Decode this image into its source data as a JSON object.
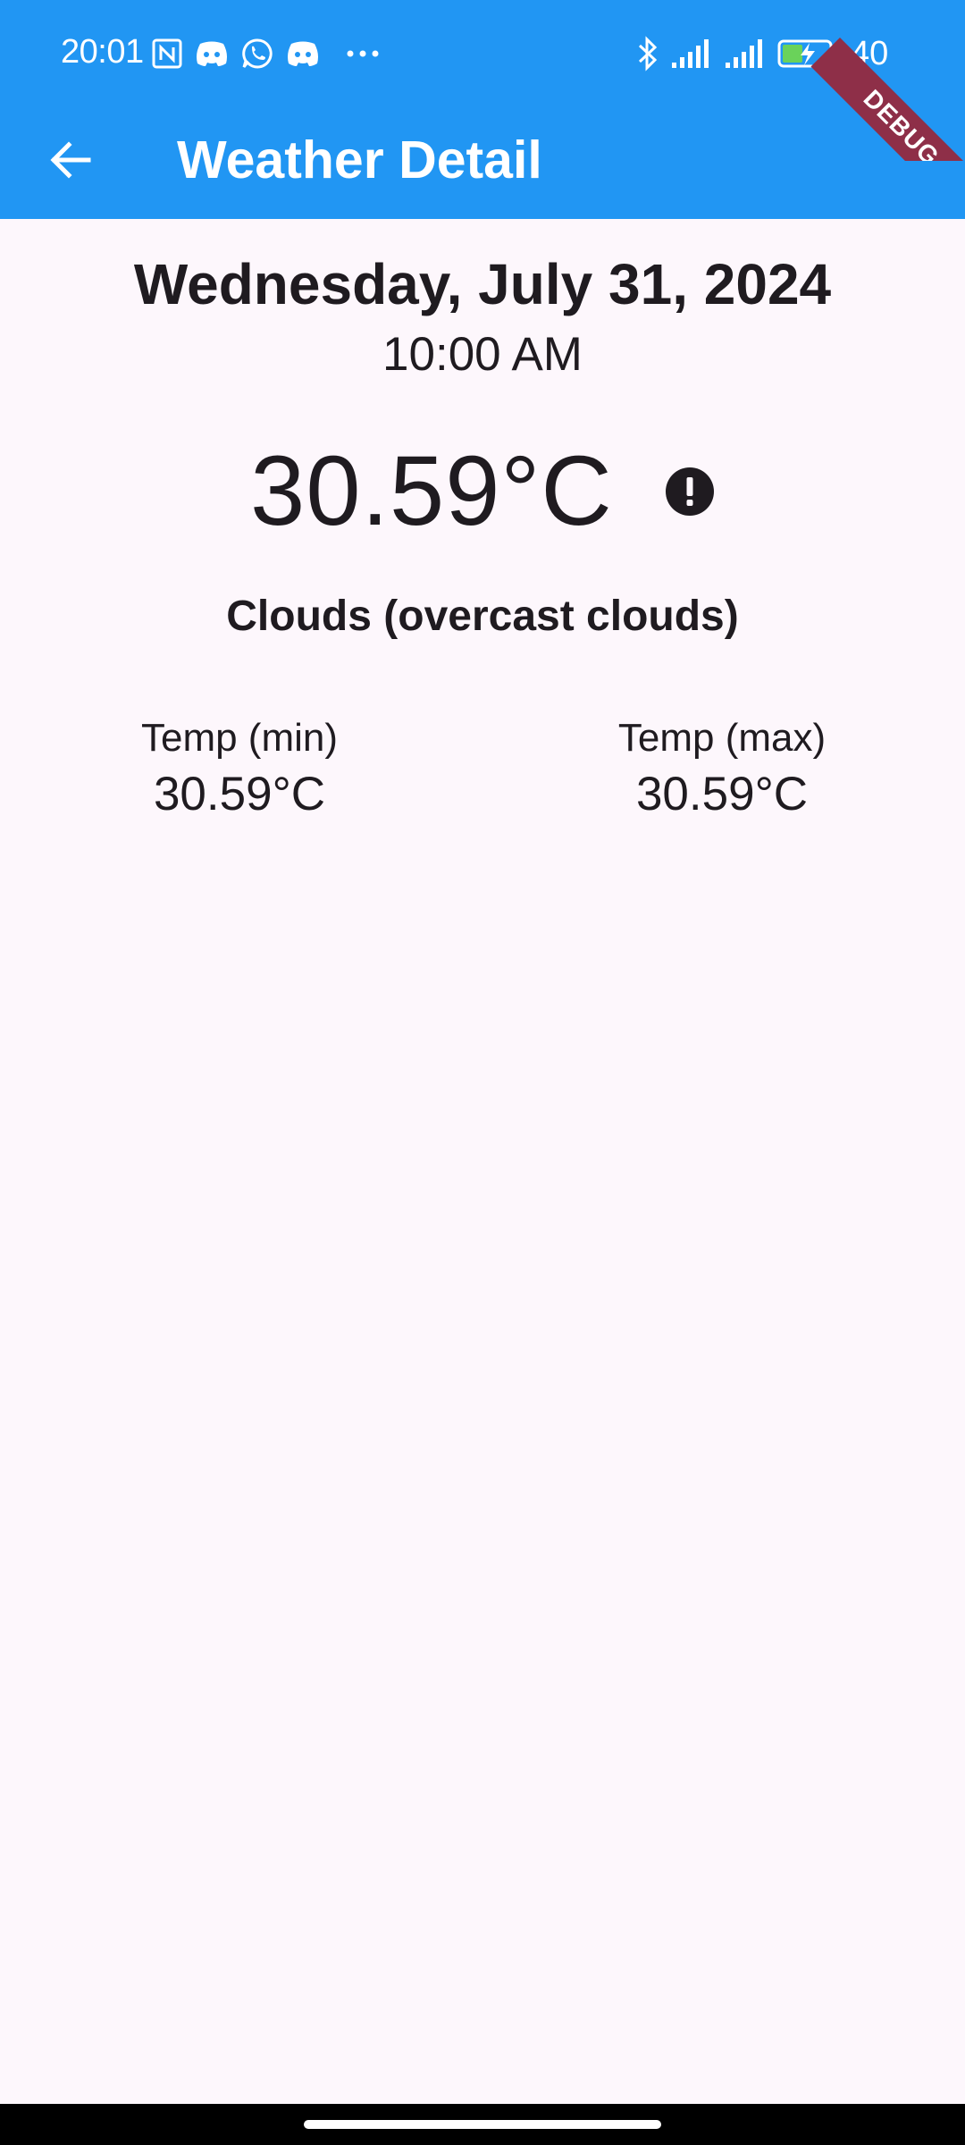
{
  "status_bar": {
    "time": "20:01",
    "battery_level": "40",
    "left_icons": [
      "nfc-icon",
      "discord-icon",
      "whatsapp-icon",
      "discord-icon",
      "more-dots-icon"
    ],
    "right_icons": [
      "bluetooth-icon",
      "signal-icon",
      "signal-icon",
      "battery-charging-icon"
    ]
  },
  "app_bar": {
    "title": "Weather Detail",
    "back_icon": "arrow-back-icon",
    "background_color": "#2196f3"
  },
  "debug_banner": {
    "label": "DEBUG",
    "color": "#8e2f48"
  },
  "weather": {
    "date": "Wednesday, July 31, 2024",
    "time": "10:00 AM",
    "temperature": "30.59°C",
    "condition_icon": "alert-circle-icon",
    "condition": "Clouds (overcast clouds)",
    "temp_min": {
      "label": "Temp (min)",
      "value": "30.59°C"
    },
    "temp_max": {
      "label": "Temp (max)",
      "value": "30.59°C"
    }
  },
  "colors": {
    "page_background": "#fdf7fc",
    "text": "#1f1b20"
  }
}
